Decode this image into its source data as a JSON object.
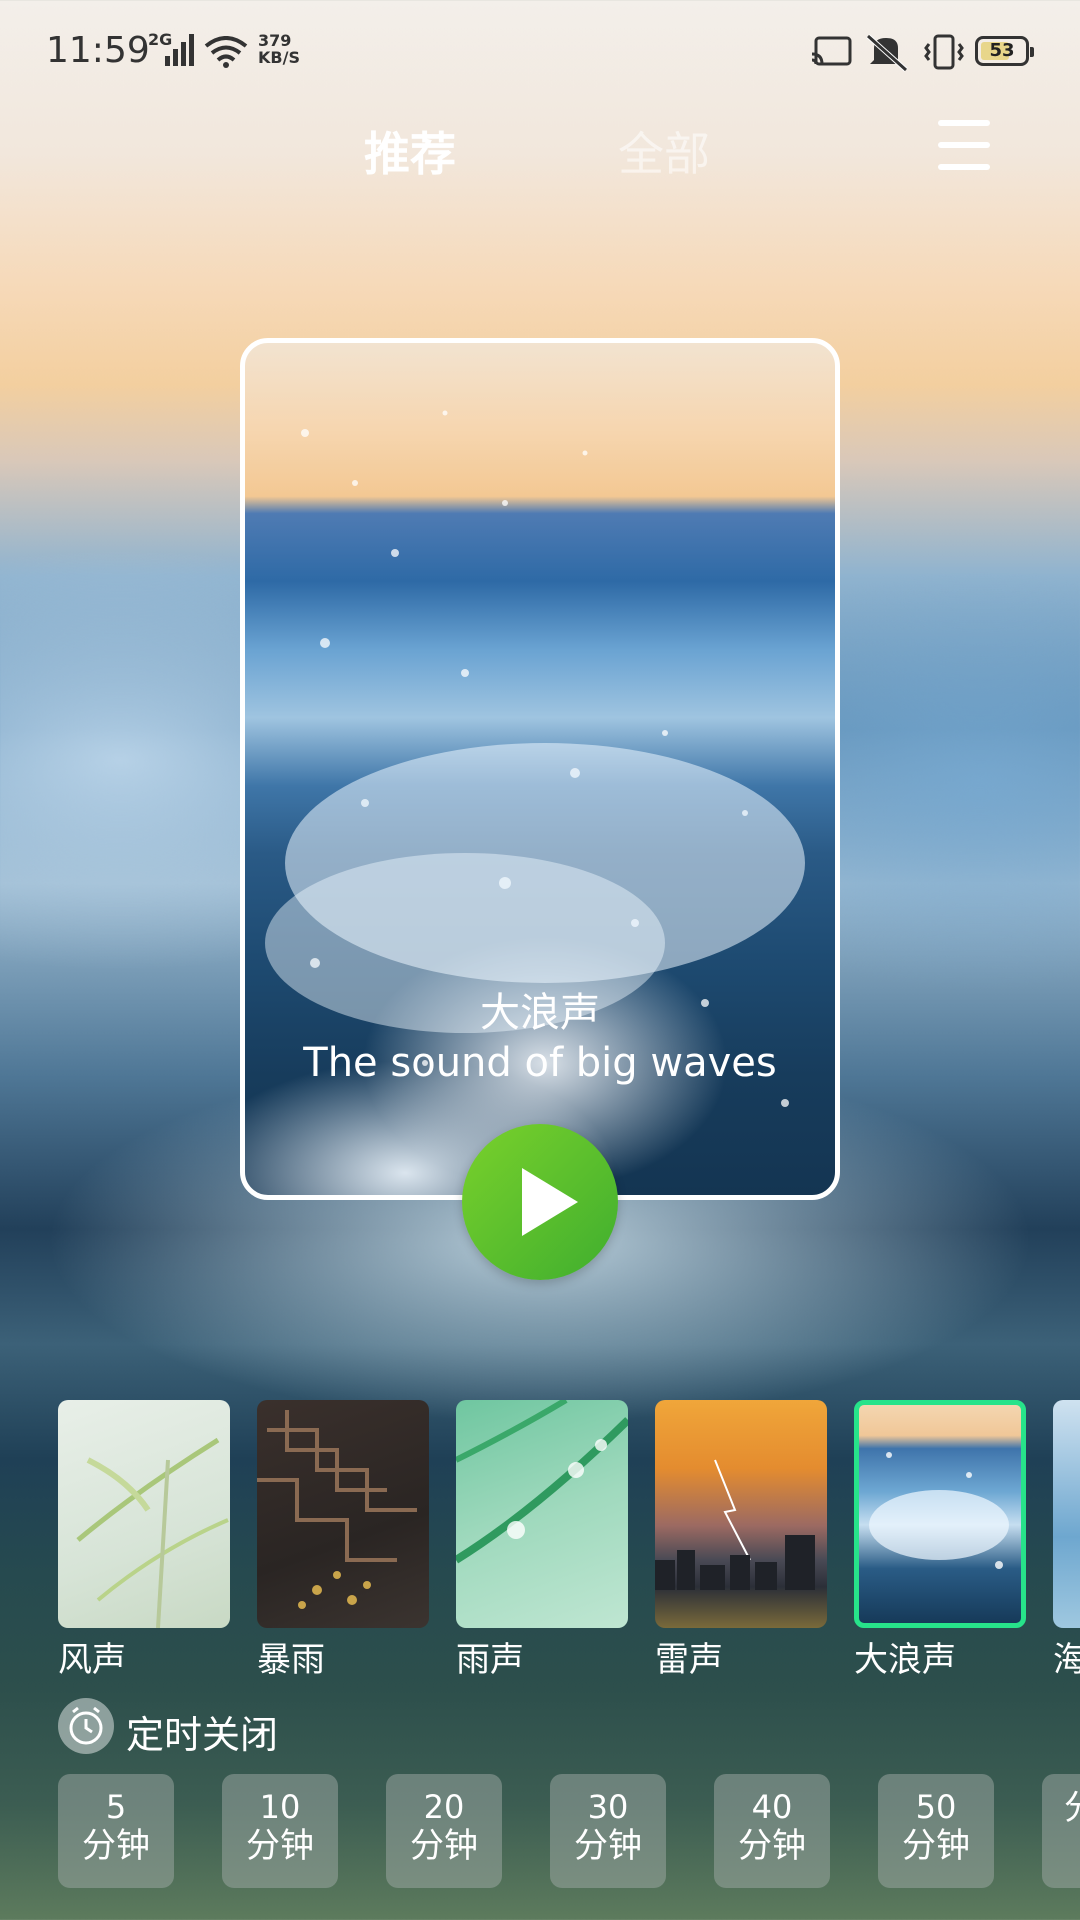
{
  "status": {
    "time": "11:59",
    "network": "2G",
    "speed_value": "379",
    "speed_unit": "KB/S",
    "battery": "53"
  },
  "nav": {
    "tab_recommend": "推荐",
    "tab_all": "全部"
  },
  "featured": {
    "title": "大浪声",
    "subtitle": "The sound of big waves"
  },
  "sounds": [
    {
      "label": "风声"
    },
    {
      "label": "暴雨"
    },
    {
      "label": "雨声"
    },
    {
      "label": "雷声"
    },
    {
      "label": "大浪声",
      "selected": true
    },
    {
      "label": "海"
    }
  ],
  "timer": {
    "label": "定时关闭",
    "options": [
      {
        "value": "5",
        "unit": "分钟"
      },
      {
        "value": "10",
        "unit": "分钟"
      },
      {
        "value": "20",
        "unit": "分钟"
      },
      {
        "value": "30",
        "unit": "分钟"
      },
      {
        "value": "40",
        "unit": "分钟"
      },
      {
        "value": "50",
        "unit": "分钟"
      },
      {
        "value": "",
        "unit": "分"
      }
    ]
  },
  "colors": {
    "accent_green": "#27e38a",
    "play_green": "#5cc12d"
  }
}
